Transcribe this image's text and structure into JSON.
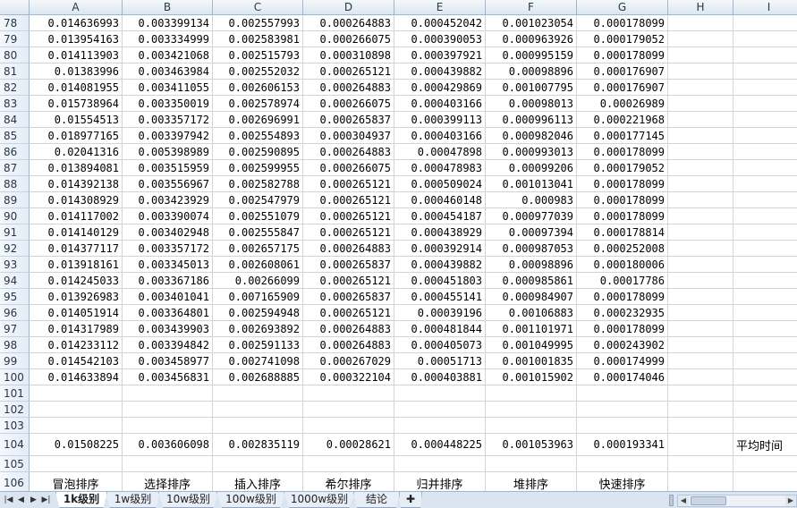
{
  "columns": [
    "A",
    "B",
    "C",
    "D",
    "E",
    "F",
    "G",
    "H",
    "I"
  ],
  "rows": [
    {
      "num": "78",
      "cells": [
        "0.014636993",
        "0.003399134",
        "0.002557993",
        "0.000264883",
        "0.000452042",
        "0.001023054",
        "0.000178099",
        "",
        ""
      ]
    },
    {
      "num": "79",
      "cells": [
        "0.013954163",
        "0.003334999",
        "0.002583981",
        "0.000266075",
        "0.000390053",
        "0.000963926",
        "0.000179052",
        "",
        ""
      ]
    },
    {
      "num": "80",
      "cells": [
        "0.014113903",
        "0.003421068",
        "0.002515793",
        "0.000310898",
        "0.000397921",
        "0.000995159",
        "0.000178099",
        "",
        ""
      ]
    },
    {
      "num": "81",
      "cells": [
        "0.01383996",
        "0.003463984",
        "0.002552032",
        "0.000265121",
        "0.000439882",
        "0.00098896",
        "0.000176907",
        "",
        ""
      ]
    },
    {
      "num": "82",
      "cells": [
        "0.014081955",
        "0.003411055",
        "0.002606153",
        "0.000264883",
        "0.000429869",
        "0.001007795",
        "0.000176907",
        "",
        ""
      ]
    },
    {
      "num": "83",
      "cells": [
        "0.015738964",
        "0.003350019",
        "0.002578974",
        "0.000266075",
        "0.000403166",
        "0.00098013",
        "0.00026989",
        "",
        ""
      ]
    },
    {
      "num": "84",
      "cells": [
        "0.01554513",
        "0.003357172",
        "0.002696991",
        "0.000265837",
        "0.000399113",
        "0.000996113",
        "0.000221968",
        "",
        ""
      ]
    },
    {
      "num": "85",
      "cells": [
        "0.018977165",
        "0.003397942",
        "0.002554893",
        "0.000304937",
        "0.000403166",
        "0.000982046",
        "0.000177145",
        "",
        ""
      ]
    },
    {
      "num": "86",
      "cells": [
        "0.02041316",
        "0.005398989",
        "0.002590895",
        "0.000264883",
        "0.00047898",
        "0.000993013",
        "0.000178099",
        "",
        ""
      ]
    },
    {
      "num": "87",
      "cells": [
        "0.013894081",
        "0.003515959",
        "0.002599955",
        "0.000266075",
        "0.000478983",
        "0.00099206",
        "0.000179052",
        "",
        ""
      ]
    },
    {
      "num": "88",
      "cells": [
        "0.014392138",
        "0.003556967",
        "0.002582788",
        "0.000265121",
        "0.000509024",
        "0.001013041",
        "0.000178099",
        "",
        ""
      ]
    },
    {
      "num": "89",
      "cells": [
        "0.014308929",
        "0.003423929",
        "0.002547979",
        "0.000265121",
        "0.000460148",
        "0.000983",
        "0.000178099",
        "",
        ""
      ]
    },
    {
      "num": "90",
      "cells": [
        "0.014117002",
        "0.003390074",
        "0.002551079",
        "0.000265121",
        "0.000454187",
        "0.000977039",
        "0.000178099",
        "",
        ""
      ]
    },
    {
      "num": "91",
      "cells": [
        "0.014140129",
        "0.003402948",
        "0.002555847",
        "0.000265121",
        "0.000438929",
        "0.00097394",
        "0.000178814",
        "",
        ""
      ]
    },
    {
      "num": "92",
      "cells": [
        "0.014377117",
        "0.003357172",
        "0.002657175",
        "0.000264883",
        "0.000392914",
        "0.000987053",
        "0.000252008",
        "",
        ""
      ]
    },
    {
      "num": "93",
      "cells": [
        "0.013918161",
        "0.003345013",
        "0.002608061",
        "0.000265837",
        "0.000439882",
        "0.00098896",
        "0.000180006",
        "",
        ""
      ]
    },
    {
      "num": "94",
      "cells": [
        "0.014245033",
        "0.003367186",
        "0.00266099",
        "0.000265121",
        "0.000451803",
        "0.000985861",
        "0.00017786",
        "",
        ""
      ]
    },
    {
      "num": "95",
      "cells": [
        "0.013926983",
        "0.003401041",
        "0.007165909",
        "0.000265837",
        "0.000455141",
        "0.000984907",
        "0.000178099",
        "",
        ""
      ]
    },
    {
      "num": "96",
      "cells": [
        "0.014051914",
        "0.003364801",
        "0.002594948",
        "0.000265121",
        "0.00039196",
        "0.00106883",
        "0.000232935",
        "",
        ""
      ]
    },
    {
      "num": "97",
      "cells": [
        "0.014317989",
        "0.003439903",
        "0.002693892",
        "0.000264883",
        "0.000481844",
        "0.001101971",
        "0.000178099",
        "",
        ""
      ]
    },
    {
      "num": "98",
      "cells": [
        "0.014233112",
        "0.003394842",
        "0.002591133",
        "0.000264883",
        "0.000405073",
        "0.001049995",
        "0.000243902",
        "",
        ""
      ]
    },
    {
      "num": "99",
      "cells": [
        "0.014542103",
        "0.003458977",
        "0.002741098",
        "0.000267029",
        "0.00051713",
        "0.001001835",
        "0.000174999",
        "",
        ""
      ]
    },
    {
      "num": "100",
      "cells": [
        "0.014633894",
        "0.003456831",
        "0.002688885",
        "0.000322104",
        "0.000403881",
        "0.001015902",
        "0.000174046",
        "",
        ""
      ]
    },
    {
      "num": "101",
      "cells": [
        "",
        "",
        "",
        "",
        "",
        "",
        "",
        "",
        ""
      ]
    },
    {
      "num": "102",
      "cells": [
        "",
        "",
        "",
        "",
        "",
        "",
        "",
        "",
        ""
      ]
    },
    {
      "num": "103",
      "cells": [
        "",
        "",
        "",
        "",
        "",
        "",
        "",
        "",
        ""
      ]
    },
    {
      "num": "104",
      "cells": [
        "0.01508225",
        "0.003606098",
        "0.002835119",
        "0.00028621",
        "0.000448225",
        "0.001053963",
        "0.000193341",
        "",
        "平均时间"
      ]
    },
    {
      "num": "105",
      "cells": [
        "",
        "",
        "",
        "",
        "",
        "",
        "",
        "",
        ""
      ]
    },
    {
      "num": "106",
      "cells": [
        "冒泡排序",
        "选择排序",
        "插入排序",
        "希尔排序",
        "归并排序",
        "堆排序",
        "快速排序",
        "",
        ""
      ]
    },
    {
      "num": "107",
      "cells": [
        "",
        "",
        "",
        "",
        "",
        "",
        "",
        "",
        ""
      ]
    }
  ],
  "tabs": [
    "1k级别",
    "1w级别",
    "10w级别",
    "100w级别",
    "1000w级别",
    "结论"
  ],
  "active_tab": "1k级别",
  "nav_buttons": [
    "first-sheet",
    "prev-sheet",
    "next-sheet",
    "last-sheet"
  ]
}
